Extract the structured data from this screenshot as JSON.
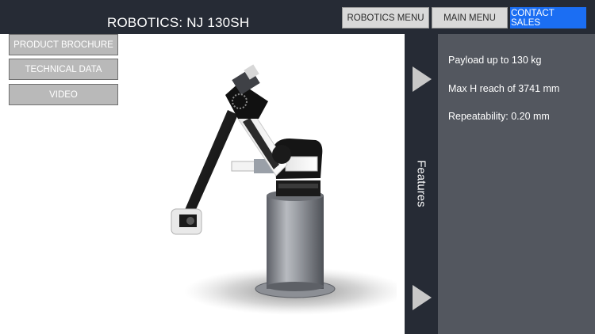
{
  "header": {
    "title": "ROBOTICS: NJ 130SH",
    "buttons": {
      "robotics_menu": "ROBOTICS MENU",
      "main_menu": "MAIN MENU",
      "contact_sales": "CONTACT SALES"
    }
  },
  "left_menu": {
    "items": [
      {
        "label": "PRODUCT BROCHURE"
      },
      {
        "label": "TECHNICAL DATA"
      },
      {
        "label": "VIDEO"
      }
    ]
  },
  "features": {
    "tab_label": "Features",
    "items": [
      {
        "text": "Payload up to 130 kg"
      },
      {
        "text": "Max H reach of 3741 mm"
      },
      {
        "text": "Repeatability: 0.20 mm"
      }
    ]
  },
  "colors": {
    "header_bg": "#262b35",
    "contact_button": "#1b6ef3",
    "panel_bg": "#53575f",
    "robot_body": "#f2f2f2",
    "robot_dark": "#141414"
  },
  "icons": {
    "next": "triangle-right-icon",
    "prev": "triangle-right-icon"
  }
}
